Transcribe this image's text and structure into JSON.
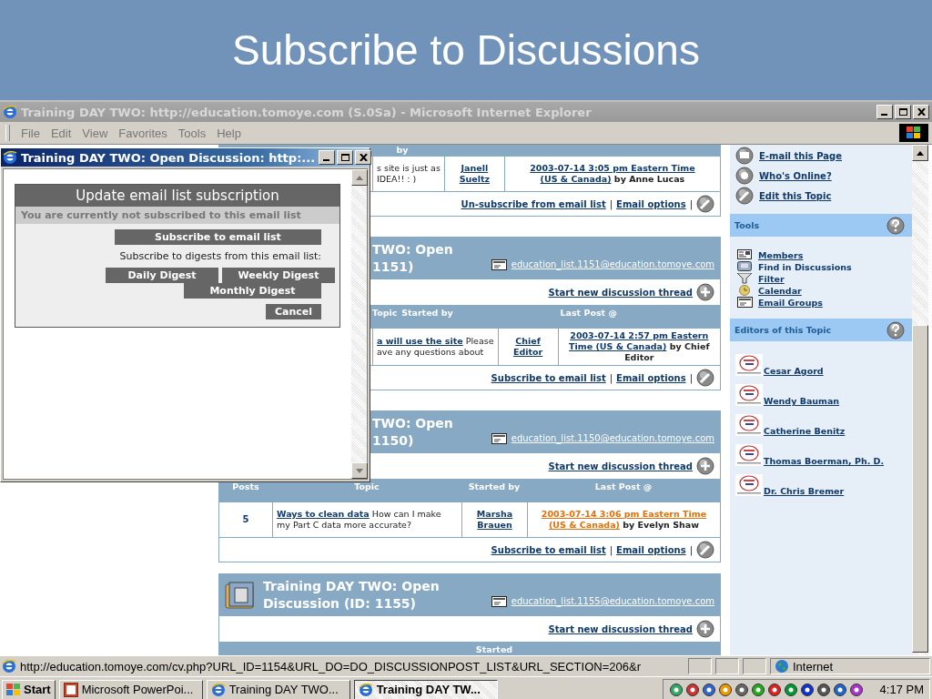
{
  "slide_title": "Subscribe to Discussions",
  "browser": {
    "title": "Training DAY TWO: http://education.tomoye.com (S.0Sa) - Microsoft Internet Explorer",
    "menu": [
      "File",
      "Edit",
      "View",
      "Favorites",
      "Tools",
      "Help"
    ]
  },
  "sections": [
    {
      "columns": {
        "started_by": "by"
      },
      "rows": [
        {
          "topic_lines": [
            [
              {
                "text": "s site is just as",
                "link": false
              }
            ],
            [
              {
                "text": "IDEA!!  : )",
                "link": false
              }
            ]
          ],
          "started_by": "Janell Sueltz",
          "highlight": false,
          "last_post_lines": [
            [
              {
                "text": "2003-07-14 3:05 pm Eastern Time",
                "link": true
              }
            ],
            [
              {
                "text": "(US & Canada)",
                "link": true
              },
              {
                "text": "by Anne Lucas",
                "link": false
              }
            ]
          ]
        }
      ],
      "actions": [
        {
          "kind": "link",
          "text": "Un-subscribe from email list"
        },
        {
          "kind": "sep",
          "text": "|"
        },
        {
          "kind": "link",
          "text": "Email options"
        },
        {
          "kind": "sep",
          "text": "|"
        }
      ]
    },
    {
      "title_lines": [
        "TWO: Open",
        "1151)"
      ],
      "list_email": "education_list.1151@education.tomoye.com",
      "start_thread": "Start new discussion thread",
      "columns": {
        "topic": "Topic",
        "started_by": "Started by",
        "last_post": "Last Post @"
      },
      "rows": [
        {
          "topic_lines": [
            [
              {
                "text": "a will use the site",
                "link": true
              },
              {
                "text": "Please",
                "link": false
              }
            ],
            [
              {
                "text": "ave any questions about",
                "link": false
              }
            ]
          ],
          "started_by": "Chief Editor",
          "highlight": false,
          "last_post_lines": [
            [
              {
                "text": "2003-07-14 2:57 pm Eastern",
                "link": true
              }
            ],
            [
              {
                "text": "Time (US & Canada)",
                "link": true
              },
              {
                "text": "by Chief",
                "link": false
              }
            ],
            [
              {
                "text": "Editor",
                "link": false
              }
            ]
          ]
        }
      ],
      "actions": [
        {
          "kind": "link",
          "text": "Subscribe to email list"
        },
        {
          "kind": "sep",
          "text": "|"
        },
        {
          "kind": "link",
          "text": "Email options"
        },
        {
          "kind": "sep",
          "text": "|"
        }
      ]
    },
    {
      "title_lines": [
        "TWO: Open",
        "1150)"
      ],
      "list_email": "education_list.1150@education.tomoye.com",
      "start_thread": "Start new discussion thread",
      "columns": {
        "posts": "Posts",
        "topic": "Topic",
        "started_by": "Started by",
        "last_post": "Last Post @"
      },
      "rows": [
        {
          "posts": "5",
          "topic_lines": [
            [
              {
                "text": "Ways to clean data",
                "link": true
              },
              {
                "text": "How can I make",
                "link": false
              }
            ],
            [
              {
                "text": "my Part C data more accurate?",
                "link": false
              }
            ]
          ],
          "started_by": "Marsha Brauen",
          "highlight": true,
          "last_post_lines": [
            [
              {
                "text": "2003-07-14 3:06 pm Eastern Time",
                "link": true
              }
            ],
            [
              {
                "text": "(US & Canada)",
                "link": true
              },
              {
                "text": "by Evelyn Shaw",
                "link": false
              }
            ]
          ]
        }
      ],
      "actions": [
        {
          "kind": "link",
          "text": "Subscribe to email list"
        },
        {
          "kind": "sep",
          "text": "|"
        },
        {
          "kind": "link",
          "text": "Email options"
        },
        {
          "kind": "sep",
          "text": "|"
        }
      ]
    },
    {
      "title_lines": [
        "Training DAY TWO: Open",
        "Discussion (ID: 1155)"
      ],
      "list_email": "education_list.1155@education.tomoye.com",
      "start_thread": "Start new discussion thread",
      "columns": {
        "started_by": "Started"
      }
    }
  ],
  "sidebar": {
    "top_links": [
      "E-mail this Page",
      "Who's Online?",
      "Edit this Topic"
    ],
    "tools": {
      "title": "Tools",
      "items": [
        {
          "text": "Members",
          "link": true
        },
        {
          "text": "Find in Discussions",
          "link": false
        },
        {
          "text": "Filter",
          "link": true
        },
        {
          "text": "Calendar",
          "link": true
        },
        {
          "text": "Email Groups",
          "link": true
        }
      ]
    },
    "editors": {
      "title": "Editors of this Topic",
      "names": [
        "Cesar Agord",
        "Wendy Bauman",
        "Catherine Benitz",
        "Thomas Boerman, Ph. D.",
        "Dr. Chris Bremer"
      ]
    }
  },
  "popup": {
    "title": "Training DAY TWO: Open Discussion: http:...",
    "heading": "Update email list subscription",
    "status": "You are currently not subscribed to this email list",
    "subscribe_button": "Subscribe to email list",
    "digest_prompt": "Subscribe to digests from this email list:",
    "digest_buttons": [
      "Daily Digest",
      "Weekly Digest",
      "Monthly Digest"
    ],
    "cancel_button": "Cancel"
  },
  "status_bar": {
    "url": "http://education.tomoye.com/cv.php?URL_ID=1154&URL_DO=DO_DISCUSSIONPOST_LIST&URL_SECTION=206&r",
    "zone": "Internet"
  },
  "taskbar": {
    "start": "Start",
    "tasks": [
      {
        "label": "Microsoft PowerPoi...",
        "selected": false
      },
      {
        "label": "Training DAY TWO...",
        "selected": false
      },
      {
        "label": "Training DAY TW...",
        "selected": true
      }
    ],
    "clock": "4:17 PM"
  }
}
